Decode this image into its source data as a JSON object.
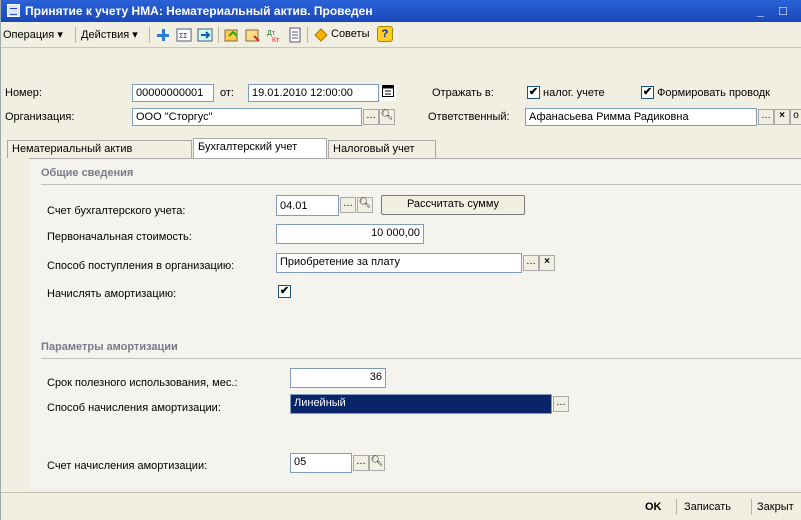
{
  "window": {
    "title": "Принятие к учету НМА: Нематериальный актив. Проведен",
    "min": "_",
    "max": "□"
  },
  "menu": {
    "operation": "Операция ▾",
    "actions": "Действия ▾",
    "tips": "Советы"
  },
  "header": {
    "number_label": "Номер:",
    "number_value": "00000000001",
    "from_label": "от:",
    "date_value": "19.01.2010 12:00:00",
    "reflect_label": "Отражать в:",
    "tax_label": "налог. учете",
    "form_label": "Формировать проводк",
    "org_label": "Организация:",
    "org_value": "ООО \"Сторгус\"",
    "resp_label": "Ответственный:",
    "resp_value": "Афанасьева Римма Радиковна"
  },
  "tabs": [
    "Нематериальный актив",
    "Бухгалтерский учет",
    "Налоговый учет"
  ],
  "general": {
    "title": "Общие сведения",
    "account_label": "Счет бухгалтерского учета:",
    "account_value": "04.01",
    "calc_button": "Рассчитать сумму",
    "cost_label": "Первоначальная стоимость:",
    "cost_value": "10 000,00",
    "method_label": "Способ поступления в организацию:",
    "method_value": "Приобретение за плату",
    "amort_label": "Начислять амортизацию:"
  },
  "amort": {
    "title": "Параметры амортизации",
    "term_label": "Срок полезного использования, мес.:",
    "term_value": "36",
    "way_label": "Способ начисления амортизации:",
    "way_value": "Линейный",
    "acc_label": "Счет начисления амортизации:",
    "acc_value": "05"
  },
  "footer": {
    "ok": "OK",
    "save": "Записать",
    "close": "Закрыт"
  },
  "colors": {
    "title_bg": "#2a62d8",
    "selection": "#0a246a",
    "window_bg": "#f1efe2"
  }
}
